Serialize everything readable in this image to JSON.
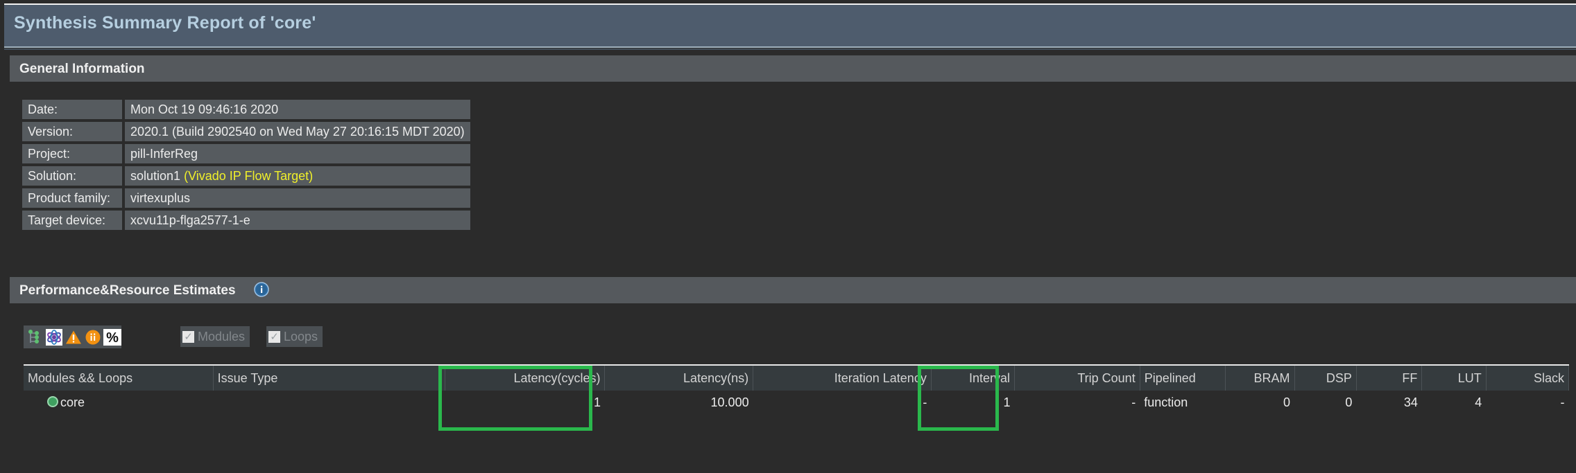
{
  "window": {
    "title": "Synthesis Summary Report of 'core'"
  },
  "general_information": {
    "section_title": "General Information",
    "rows": [
      {
        "label": "Date:",
        "value": "Mon Oct 19 09:46:16 2020",
        "extra": ""
      },
      {
        "label": "Version:",
        "value": "2020.1 (Build 2902540 on Wed May 27 20:16:15 MDT 2020)",
        "extra": ""
      },
      {
        "label": "Project:",
        "value": "pill-InferReg",
        "extra": ""
      },
      {
        "label": "Solution:",
        "value": "solution1",
        "extra": "(Vivado IP Flow Target)"
      },
      {
        "label": "Product family:",
        "value": "virtexuplus",
        "extra": ""
      },
      {
        "label": "Target device:",
        "value": "xcvu11p-flga2577-1-e",
        "extra": ""
      }
    ]
  },
  "performance": {
    "section_title": "Performance&Resource Estimates",
    "info_icon": "info-icon",
    "toolbar": [
      {
        "name": "expand-hierarchy-icon",
        "tooltip": "Expand/Collapse Hierarchy"
      },
      {
        "name": "atom-icon",
        "tooltip": "Show Resource Profile"
      },
      {
        "name": "warning-triangle-icon",
        "tooltip": "Show Warnings"
      },
      {
        "name": "info-circle-icon",
        "tooltip": "Show Info"
      },
      {
        "name": "percent-icon",
        "tooltip": "Show Percentage"
      }
    ],
    "filters": [
      {
        "label": "Modules",
        "checked": true,
        "enabled": false
      },
      {
        "label": "Loops",
        "checked": true,
        "enabled": false
      }
    ],
    "table": {
      "columns": [
        "Modules && Loops",
        "Issue Type",
        "Latency(cycles)",
        "Latency(ns)",
        "Iteration Latency",
        "Interval",
        "Trip Count",
        "Pipelined",
        "BRAM",
        "DSP",
        "FF",
        "LUT",
        "Slack"
      ],
      "rows": [
        {
          "module": "core",
          "issue_type": "",
          "latency_cycles": "1",
          "latency_ns": "10.000",
          "iteration_latency": "-",
          "interval": "1",
          "trip_count": "-",
          "pipelined": "function",
          "bram": "0",
          "dsp": "0",
          "ff": "34",
          "lut": "4",
          "slack": "-"
        }
      ]
    }
  },
  "annotations": {
    "highlight_color": "#2ab84c",
    "boxes": [
      {
        "name": "latency-cycles-highlight",
        "target": "Latency(cycles)"
      },
      {
        "name": "interval-highlight",
        "target": "Interval"
      }
    ]
  },
  "colors": {
    "title_bar": "#4e5c6d",
    "title_text": "#b6cfe0",
    "panel_header": "#55595d",
    "body_bg": "#2b2b2b",
    "field_bg": "#565b5f",
    "accent_yellow": "#f0f02a",
    "table_header_bg": "#353b3e"
  }
}
